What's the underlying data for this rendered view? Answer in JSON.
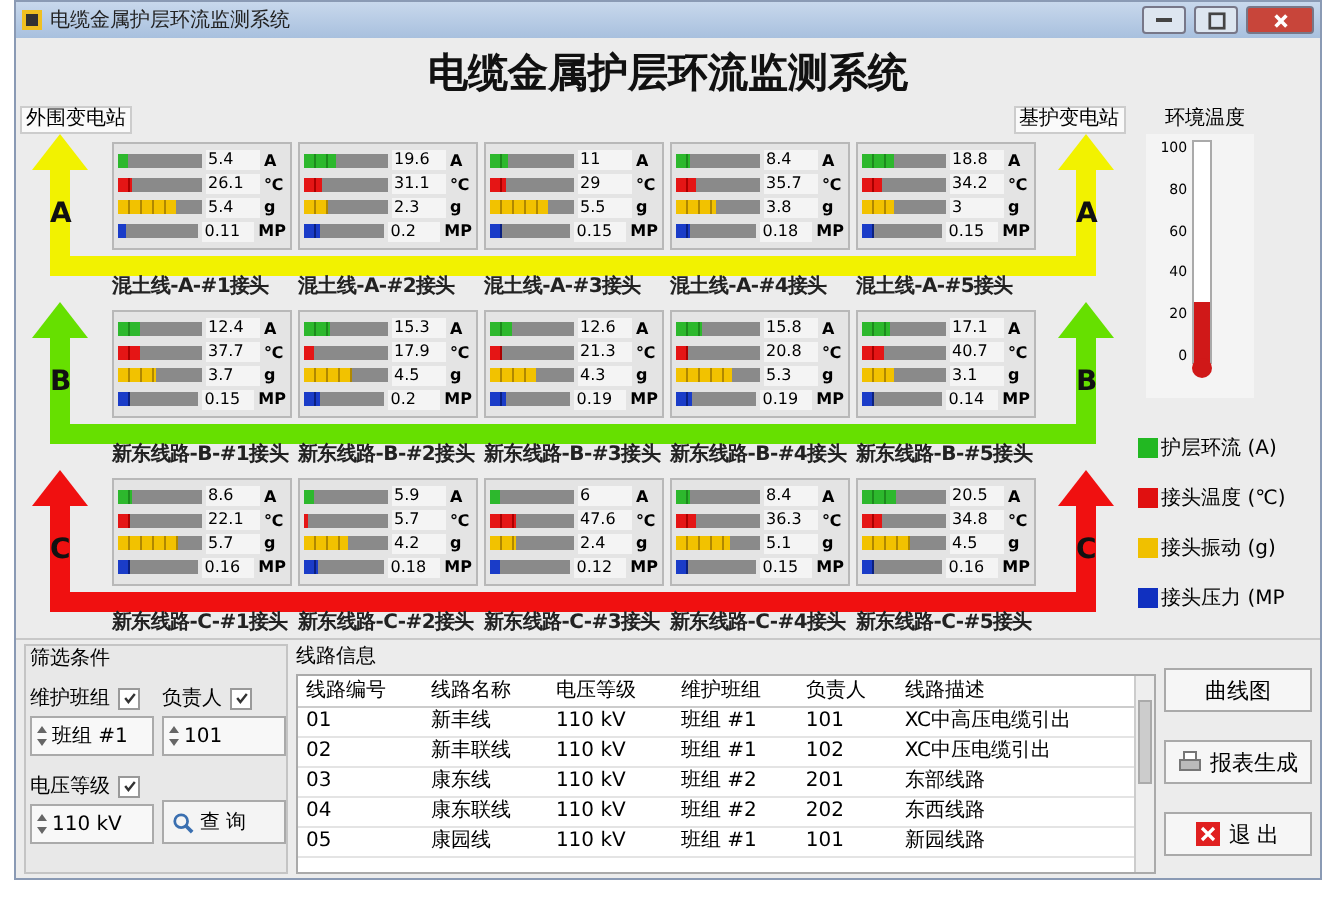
{
  "window": {
    "title": "电缆金属护层环流监测系统"
  },
  "header": {
    "title": "电缆金属护层环流监测系统"
  },
  "stations": {
    "left": "外围变电站",
    "right": "基护变电站"
  },
  "phases": [
    {
      "labels": [
        "A",
        "A"
      ],
      "color": "#f2f200",
      "joints": [
        {
          "name": "混土线-A-#1接头",
          "readings": [
            {
              "kind": "current",
              "level": 0.11,
              "value": "5.4",
              "unit": "A"
            },
            {
              "kind": "temperature",
              "level": 0.17,
              "value": "26.1",
              "unit": "℃"
            },
            {
              "kind": "vibration",
              "level": 0.68,
              "value": "5.4",
              "unit": "g"
            },
            {
              "kind": "pressure",
              "level": 0.11,
              "value": "0.11",
              "unit": "MP"
            }
          ]
        },
        {
          "name": "混土线-A-#2接头",
          "readings": [
            {
              "kind": "current",
              "level": 0.39,
              "value": "19.6",
              "unit": "A"
            },
            {
              "kind": "temperature",
              "level": 0.21,
              "value": "31.1",
              "unit": "℃"
            },
            {
              "kind": "vibration",
              "level": 0.29,
              "value": "2.3",
              "unit": "g"
            },
            {
              "kind": "pressure",
              "level": 0.2,
              "value": "0.2",
              "unit": "MP"
            }
          ]
        },
        {
          "name": "混土线-A-#3接头",
          "readings": [
            {
              "kind": "current",
              "level": 0.22,
              "value": "11",
              "unit": "A"
            },
            {
              "kind": "temperature",
              "level": 0.19,
              "value": "29",
              "unit": "℃"
            },
            {
              "kind": "vibration",
              "level": 0.69,
              "value": "5.5",
              "unit": "g"
            },
            {
              "kind": "pressure",
              "level": 0.15,
              "value": "0.15",
              "unit": "MP"
            }
          ]
        },
        {
          "name": "混土线-A-#4接头",
          "readings": [
            {
              "kind": "current",
              "level": 0.17,
              "value": "8.4",
              "unit": "A"
            },
            {
              "kind": "temperature",
              "level": 0.24,
              "value": "35.7",
              "unit": "℃"
            },
            {
              "kind": "vibration",
              "level": 0.48,
              "value": "3.8",
              "unit": "g"
            },
            {
              "kind": "pressure",
              "level": 0.18,
              "value": "0.18",
              "unit": "MP"
            }
          ]
        },
        {
          "name": "混土线-A-#5接头",
          "readings": [
            {
              "kind": "current",
              "level": 0.38,
              "value": "18.8",
              "unit": "A"
            },
            {
              "kind": "temperature",
              "level": 0.23,
              "value": "34.2",
              "unit": "℃"
            },
            {
              "kind": "vibration",
              "level": 0.38,
              "value": "3",
              "unit": "g"
            },
            {
              "kind": "pressure",
              "level": 0.15,
              "value": "0.15",
              "unit": "MP"
            }
          ]
        }
      ]
    },
    {
      "labels": [
        "B",
        "B"
      ],
      "color": "#66e000",
      "joints": [
        {
          "name": "新东线路-B-#1接头",
          "readings": [
            {
              "kind": "current",
              "level": 0.25,
              "value": "12.4",
              "unit": "A"
            },
            {
              "kind": "temperature",
              "level": 0.25,
              "value": "37.7",
              "unit": "℃"
            },
            {
              "kind": "vibration",
              "level": 0.46,
              "value": "3.7",
              "unit": "g"
            },
            {
              "kind": "pressure",
              "level": 0.15,
              "value": "0.15",
              "unit": "MP"
            }
          ]
        },
        {
          "name": "新东线路-B-#2接头",
          "readings": [
            {
              "kind": "current",
              "level": 0.31,
              "value": "15.3",
              "unit": "A"
            },
            {
              "kind": "temperature",
              "level": 0.12,
              "value": "17.9",
              "unit": "℃"
            },
            {
              "kind": "vibration",
              "level": 0.56,
              "value": "4.5",
              "unit": "g"
            },
            {
              "kind": "pressure",
              "level": 0.2,
              "value": "0.2",
              "unit": "MP"
            }
          ]
        },
        {
          "name": "新东线路-B-#3接头",
          "readings": [
            {
              "kind": "current",
              "level": 0.25,
              "value": "12.6",
              "unit": "A"
            },
            {
              "kind": "temperature",
              "level": 0.14,
              "value": "21.3",
              "unit": "℃"
            },
            {
              "kind": "vibration",
              "level": 0.54,
              "value": "4.3",
              "unit": "g"
            },
            {
              "kind": "pressure",
              "level": 0.19,
              "value": "0.19",
              "unit": "MP"
            }
          ]
        },
        {
          "name": "新东线路-B-#4接头",
          "readings": [
            {
              "kind": "current",
              "level": 0.32,
              "value": "15.8",
              "unit": "A"
            },
            {
              "kind": "temperature",
              "level": 0.14,
              "value": "20.8",
              "unit": "℃"
            },
            {
              "kind": "vibration",
              "level": 0.66,
              "value": "5.3",
              "unit": "g"
            },
            {
              "kind": "pressure",
              "level": 0.19,
              "value": "0.19",
              "unit": "MP"
            }
          ]
        },
        {
          "name": "新东线路-B-#5接头",
          "readings": [
            {
              "kind": "current",
              "level": 0.34,
              "value": "17.1",
              "unit": "A"
            },
            {
              "kind": "temperature",
              "level": 0.27,
              "value": "40.7",
              "unit": "℃"
            },
            {
              "kind": "vibration",
              "level": 0.39,
              "value": "3.1",
              "unit": "g"
            },
            {
              "kind": "pressure",
              "level": 0.14,
              "value": "0.14",
              "unit": "MP"
            }
          ]
        }
      ]
    },
    {
      "labels": [
        "C",
        "C"
      ],
      "color": "#f01010",
      "joints": [
        {
          "name": "新东线路-C-#1接头",
          "readings": [
            {
              "kind": "current",
              "level": 0.17,
              "value": "8.6",
              "unit": "A"
            },
            {
              "kind": "temperature",
              "level": 0.15,
              "value": "22.1",
              "unit": "℃"
            },
            {
              "kind": "vibration",
              "level": 0.71,
              "value": "5.7",
              "unit": "g"
            },
            {
              "kind": "pressure",
              "level": 0.16,
              "value": "0.16",
              "unit": "MP"
            }
          ]
        },
        {
          "name": "新东线路-C-#2接头",
          "readings": [
            {
              "kind": "current",
              "level": 0.12,
              "value": "5.9",
              "unit": "A"
            },
            {
              "kind": "temperature",
              "level": 0.04,
              "value": "5.7",
              "unit": "℃"
            },
            {
              "kind": "vibration",
              "level": 0.53,
              "value": "4.2",
              "unit": "g"
            },
            {
              "kind": "pressure",
              "level": 0.18,
              "value": "0.18",
              "unit": "MP"
            }
          ]
        },
        {
          "name": "新东线路-C-#3接头",
          "readings": [
            {
              "kind": "current",
              "level": 0.12,
              "value": "6",
              "unit": "A"
            },
            {
              "kind": "temperature",
              "level": 0.32,
              "value": "47.6",
              "unit": "℃"
            },
            {
              "kind": "vibration",
              "level": 0.3,
              "value": "2.4",
              "unit": "g"
            },
            {
              "kind": "pressure",
              "level": 0.12,
              "value": "0.12",
              "unit": "MP"
            }
          ]
        },
        {
          "name": "新东线路-C-#4接头",
          "readings": [
            {
              "kind": "current",
              "level": 0.17,
              "value": "8.4",
              "unit": "A"
            },
            {
              "kind": "temperature",
              "level": 0.24,
              "value": "36.3",
              "unit": "℃"
            },
            {
              "kind": "vibration",
              "level": 0.64,
              "value": "5.1",
              "unit": "g"
            },
            {
              "kind": "pressure",
              "level": 0.15,
              "value": "0.15",
              "unit": "MP"
            }
          ]
        },
        {
          "name": "新东线路-C-#5接头",
          "readings": [
            {
              "kind": "current",
              "level": 0.41,
              "value": "20.5",
              "unit": "A"
            },
            {
              "kind": "temperature",
              "level": 0.23,
              "value": "34.8",
              "unit": "℃"
            },
            {
              "kind": "vibration",
              "level": 0.56,
              "value": "4.5",
              "unit": "g"
            },
            {
              "kind": "pressure",
              "level": 0.16,
              "value": "0.16",
              "unit": "MP"
            }
          ]
        }
      ]
    }
  ],
  "temperature": {
    "label": "环境温度",
    "ticks": [
      "100",
      "80",
      "60",
      "40",
      "20",
      "0"
    ],
    "level": 0.27
  },
  "legend": [
    {
      "label": "护层环流 (A)",
      "color": "#22b822"
    },
    {
      "label": "接头温度 (℃)",
      "color": "#e01010"
    },
    {
      "label": "接头振动 (g)",
      "color": "#f0c000"
    },
    {
      "label": "接头压力 (MP",
      "color": "#1030c0"
    }
  ],
  "filter": {
    "title": "筛选条件",
    "fields": [
      {
        "label": "维护班组",
        "checked": true,
        "value": "班组 #1"
      },
      {
        "label": "负责人",
        "checked": true,
        "value": "101"
      },
      {
        "label": "电压等级",
        "checked": true,
        "value": "110 kV"
      }
    ],
    "search": "查 询"
  },
  "table": {
    "title": "线路信息",
    "columns": [
      "线路编号",
      "线路名称",
      "电压等级",
      "维护班组",
      "负责人",
      "线路描述"
    ],
    "rows": [
      [
        "01",
        "新丰线",
        "110 kV",
        "班组 #1",
        "101",
        "XC中高压电缆引出"
      ],
      [
        "02",
        "新丰联线",
        "110 kV",
        "班组 #1",
        "102",
        "XC中压电缆引出"
      ],
      [
        "03",
        "康东线",
        "110 kV",
        "班组 #2",
        "201",
        "东部线路"
      ],
      [
        "04",
        "康东联线",
        "110 kV",
        "班组 #2",
        "202",
        "东西线路"
      ],
      [
        "05",
        "康园线",
        "110 kV",
        "班组 #1",
        "101",
        "新园线路"
      ]
    ]
  },
  "buttons": [
    {
      "kind": "chart",
      "label": "曲线图"
    },
    {
      "kind": "report",
      "label": "报表生成"
    },
    {
      "kind": "exit",
      "label": "退 出"
    }
  ]
}
